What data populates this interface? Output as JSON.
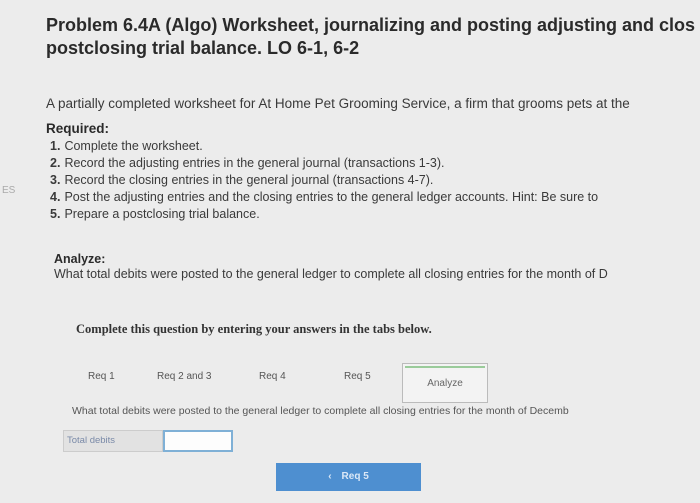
{
  "problem": {
    "title_line1": "Problem 6.4A (Algo) Worksheet, journalizing and posting adjusting and clos",
    "title_line2": "postclosing trial balance. LO 6-1, 6-2",
    "intro": "A partially completed worksheet for At Home Pet Grooming Service, a firm that grooms pets at the"
  },
  "required": {
    "heading": "Required:",
    "items": [
      {
        "num": "1.",
        "text": "Complete the worksheet."
      },
      {
        "num": "2.",
        "text": "Record the adjusting entries in the general journal (transactions 1-3)."
      },
      {
        "num": "3.",
        "text": "Record the closing entries in the general journal (transactions 4-7)."
      },
      {
        "num": "4.",
        "text": "Post the adjusting entries and the closing entries to the general ledger accounts. Hint: Be sure to"
      },
      {
        "num": "5.",
        "text": "Prepare a postclosing trial balance."
      }
    ]
  },
  "side_mark": "ES",
  "analyze": {
    "heading": "Analyze:",
    "question": "What total debits were posted to the general ledger to complete all closing entries for the month of D"
  },
  "instruction": "Complete this question by entering your answers in the tabs below.",
  "tabs": [
    {
      "label": "Req 1"
    },
    {
      "label": "Req 2 and 3"
    },
    {
      "label": "Req 4"
    },
    {
      "label": "Req 5"
    },
    {
      "label": "Analyze"
    }
  ],
  "tab_content": {
    "question": "What total debits were posted to the general ledger to complete all closing entries for the month of Decemb",
    "answer_label": "Total debits",
    "answer_value": ""
  },
  "nav": {
    "prev_label": "Req 5",
    "prev_icon": "chevron-left-icon"
  }
}
